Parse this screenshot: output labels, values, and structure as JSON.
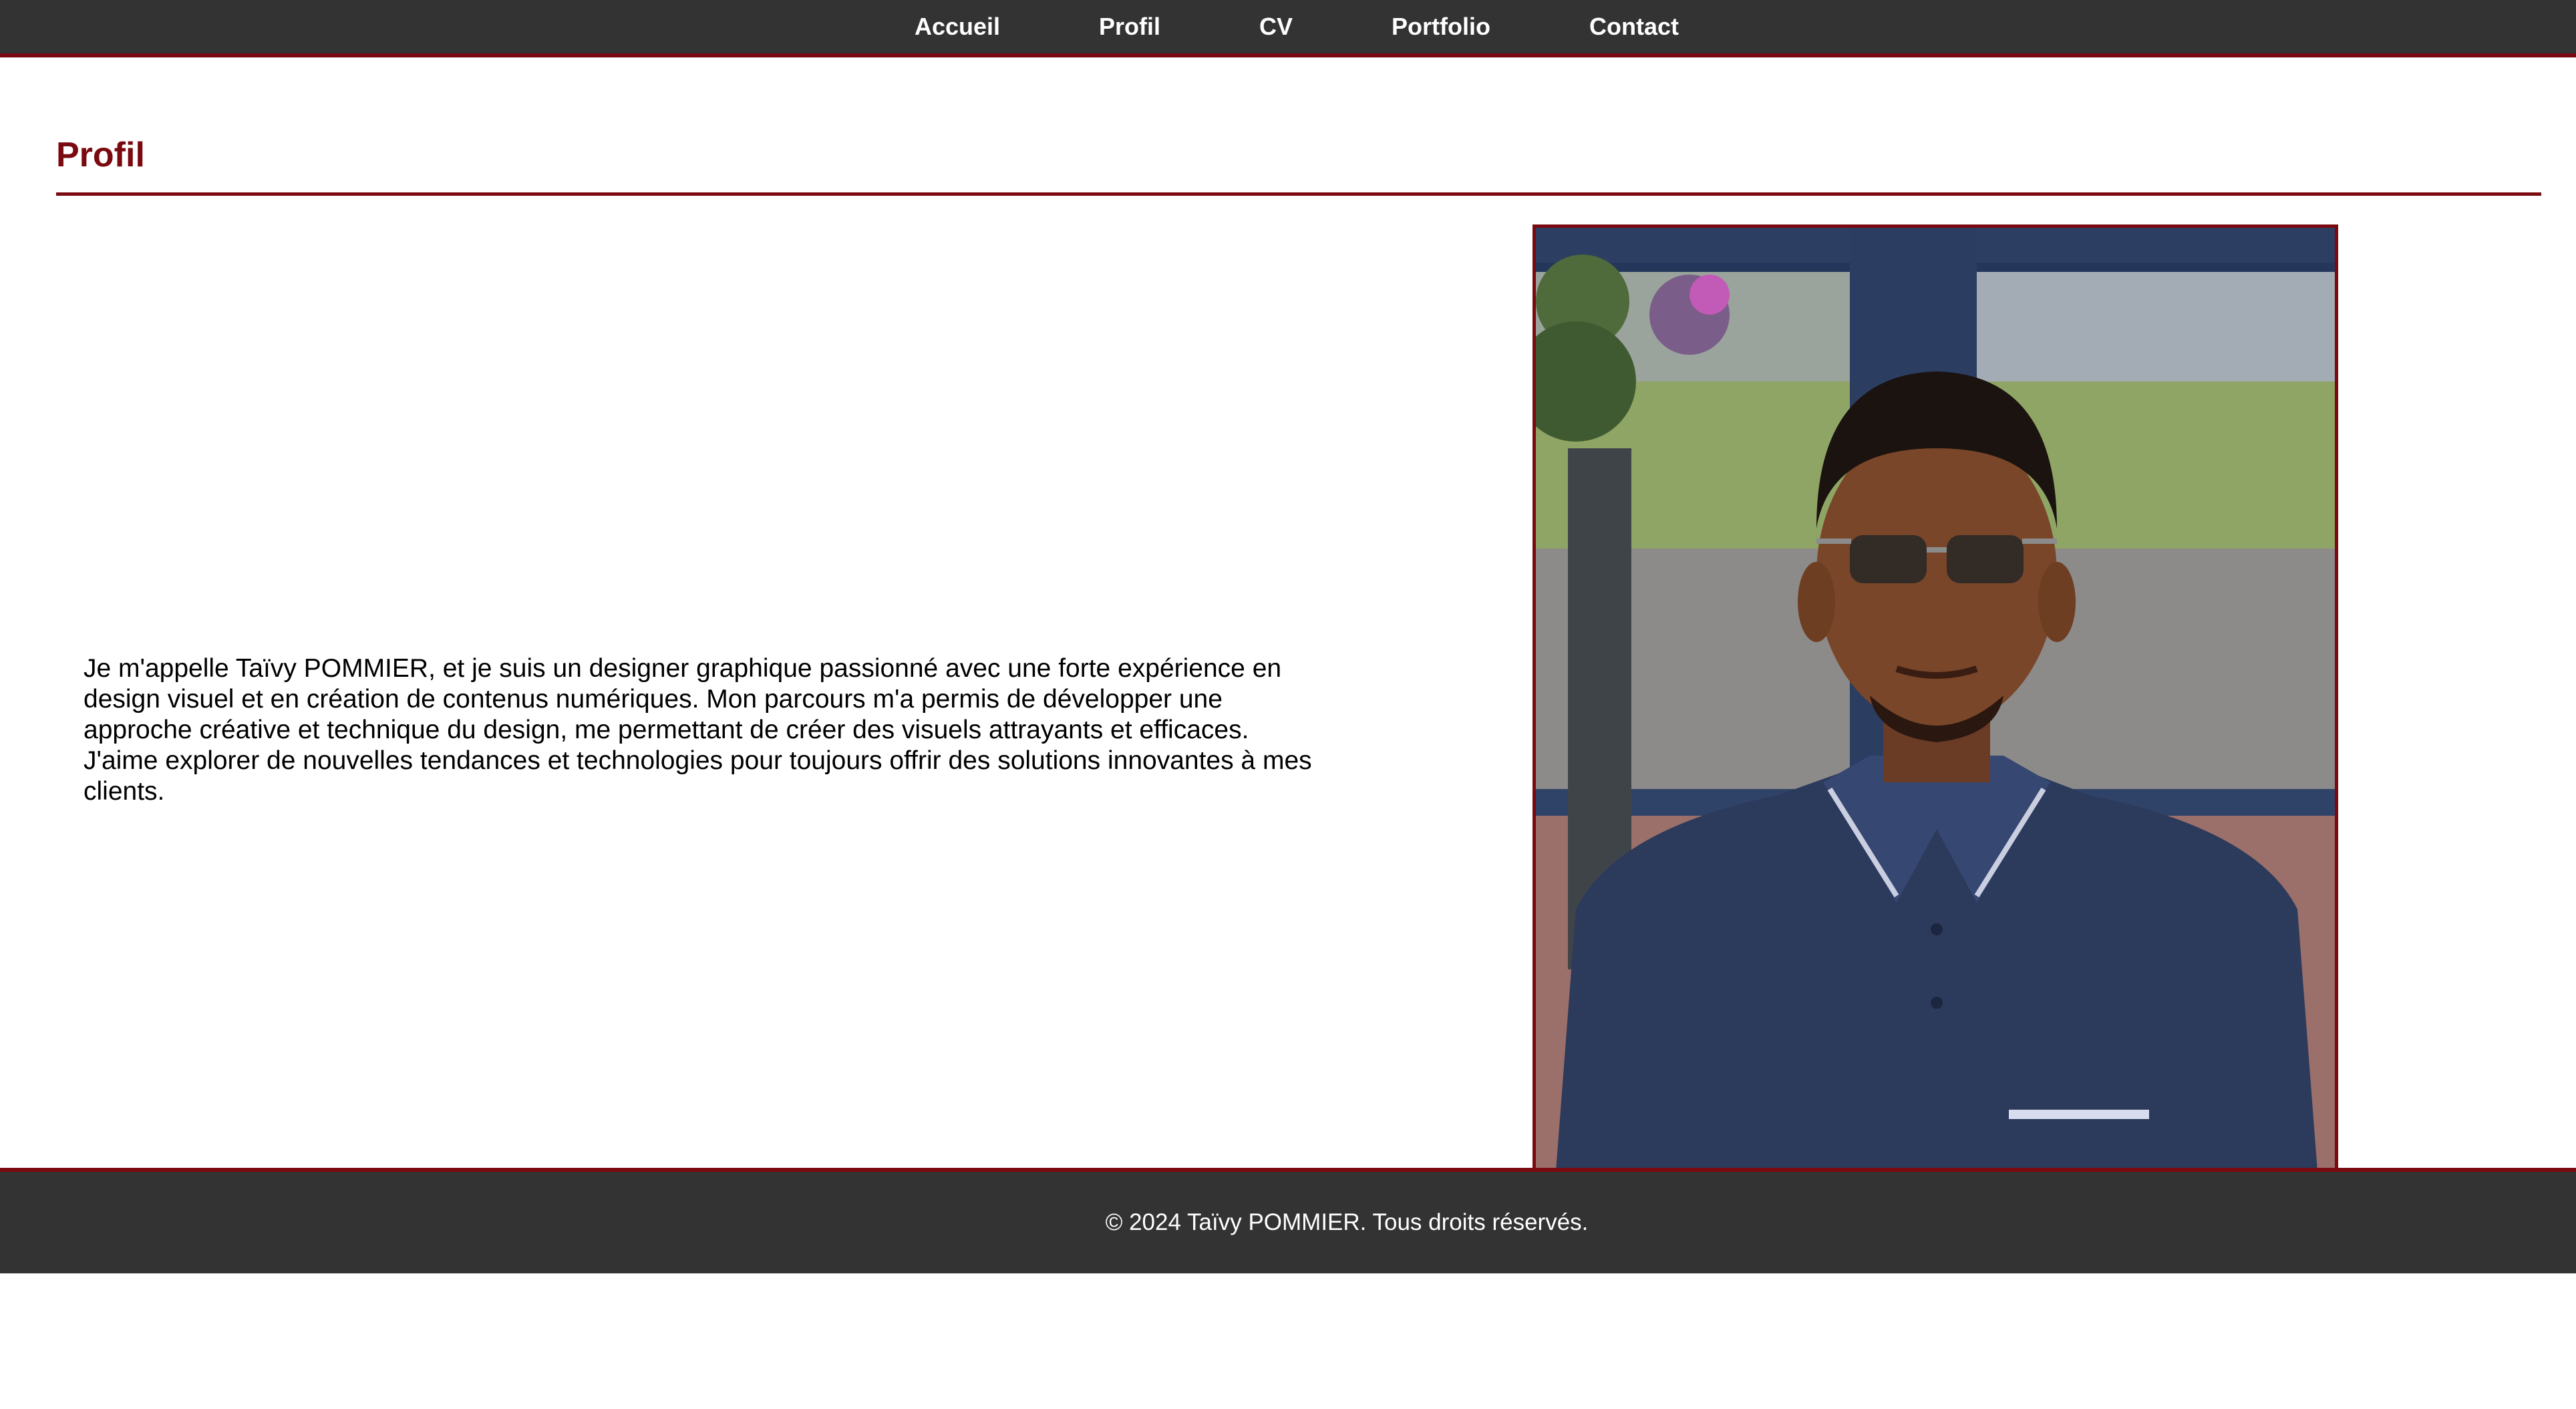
{
  "nav": {
    "items": [
      {
        "label": "Accueil"
      },
      {
        "label": "Profil"
      },
      {
        "label": "CV"
      },
      {
        "label": "Portfolio"
      },
      {
        "label": "Contact"
      }
    ]
  },
  "profile": {
    "heading": "Profil",
    "bio": "Je m'appelle Taïvy POMMIER, et je suis un designer graphique passionné avec une forte expérience en design visuel et en création de contenus numériques. Mon parcours m'a permis de développer une approche créative et technique du design, me permettant de créer des visuels attrayants et efficaces. J'aime explorer de nouvelles tendances et technologies pour toujours offrir des solutions innovantes à mes clients."
  },
  "footer": {
    "copyright": "© 2024 Taïvy POMMIER. Tous droits réservés."
  },
  "colors": {
    "accent": "#7a0a10",
    "bar": "#333333",
    "background": "#ffffff"
  }
}
